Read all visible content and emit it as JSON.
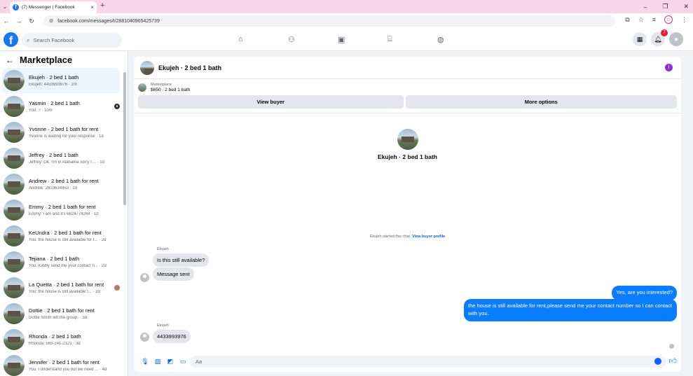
{
  "browser": {
    "tab_title": "(7) Messenger | Facebook",
    "tab_favicon": "f",
    "tab_close": "×",
    "new_tab": "+",
    "url": "facebook.com/messages/t/28810409654257​39",
    "min": "–",
    "restore": "❐",
    "close": "✕"
  },
  "fb": {
    "logo": "f",
    "search_placeholder": "Search Facebook",
    "notif_count": "7"
  },
  "sidebar": {
    "title": "Marketplace",
    "conversations": [
      {
        "name": "Ekujeh · 2 bed 1 bath",
        "sub": "Ekujeh: 4433993976 · 1m"
      },
      {
        "name": "Yasmin · 2 bed 1 bath",
        "sub": "You: ? · 10m"
      },
      {
        "name": "Yvonne · 2 bed 1 bath for rent",
        "sub": "Yvonne is waiting for your response · 1d"
      },
      {
        "name": "Jeffrey · 2 bed 1 bath",
        "sub": "Jeffrey: Ok. I'm in Alabama sorry I'... · 1d"
      },
      {
        "name": "Andrew · 2 bed 1 bath for rent",
        "sub": "Andrew: 2603634453 · 1d"
      },
      {
        "name": "Emmy · 2 bed 1 bath for rent",
        "sub": "Emmy: I am and it's 6624774264 · 1d"
      },
      {
        "name": "KeUndra · 2 bed 1 bath for rent",
        "sub": "You: the house is still available for r... · 2d"
      },
      {
        "name": "Tejiana · 2 bed 1 bath",
        "sub": "You: Kindly send me your contact n... · 2d"
      },
      {
        "name": "La Quetta · 2 bed 1 bath for rent",
        "sub": "You: the house is still available f... · 2d"
      },
      {
        "name": "Dottie · 2 bed 1 bath for rent",
        "sub": "Dottie Smith left the group. · 3d"
      },
      {
        "name": "Rhonda · 2 bed 1 bath",
        "sub": "Rhonda: 563-241-2121 · 3d"
      },
      {
        "name": "Jennifer · 2 bed 1 bath for rent",
        "sub": "You: I understand you but we need ... · 4d"
      }
    ]
  },
  "chat": {
    "title": "Ekujeh · 2 bed 1 bath",
    "marketplace_label": "Marketplace",
    "price_line": "$650 · 2 bed 1 bath",
    "view_buyer": "View buyer",
    "more_options": "More options",
    "center_title": "Ekujeh · 2 bed 1 bath",
    "started_text": "Ekujeh started this chat.",
    "view_buyer_profile": "View buyer profile",
    "sender": "Ekujeh",
    "msg1": "Is this still available?",
    "msg2": "Message sent",
    "out1": "Yes, are you interested?",
    "out2": "the house is still available for rent,please send me your contact number so I can contact with you.",
    "msg3": "4433993976",
    "composer_placeholder": "Aa"
  }
}
